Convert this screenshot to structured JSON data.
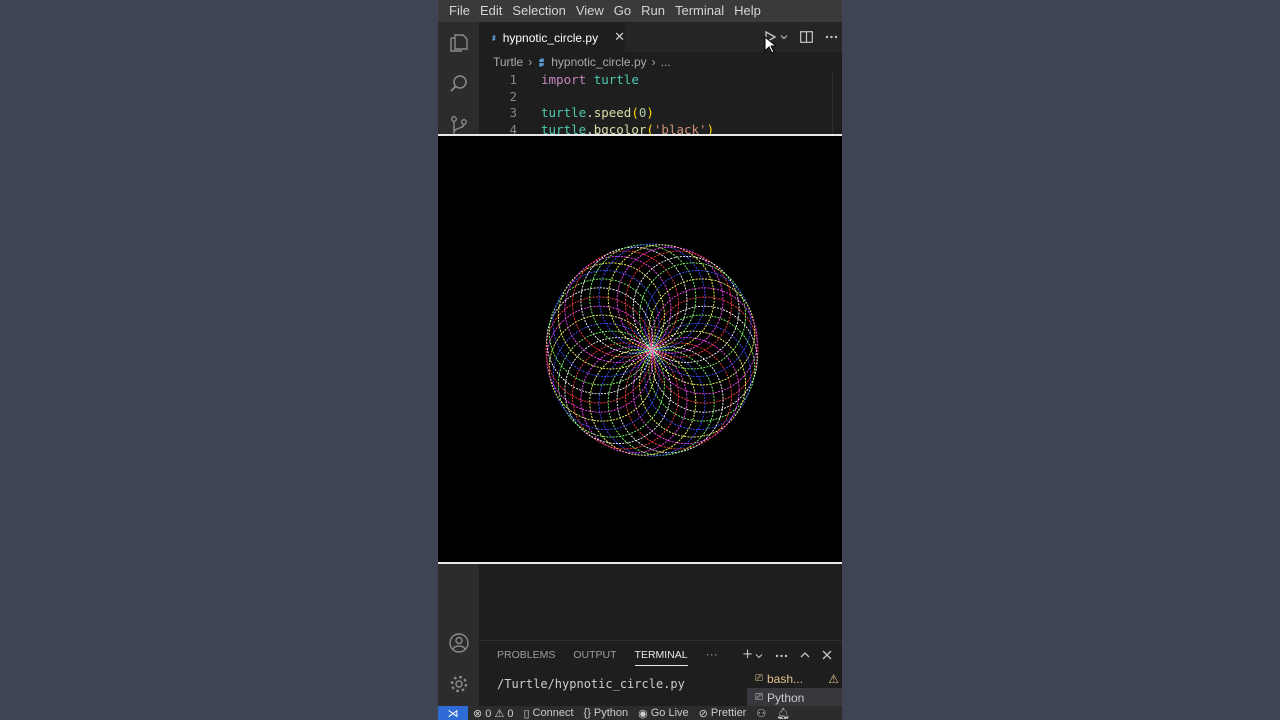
{
  "menu": [
    "File",
    "Edit",
    "Selection",
    "View",
    "Go",
    "Run",
    "Terminal",
    "Help"
  ],
  "tab": {
    "label": "hypnotic_circle.py",
    "close": "✕"
  },
  "breadcrumb": {
    "folder": "Turtle",
    "file": "hypnotic_circle.py",
    "more": "..."
  },
  "code": [
    {
      "n": "1",
      "tokens": [
        {
          "t": "import",
          "c": "kw"
        },
        {
          "t": " ",
          "c": "pn"
        },
        {
          "t": "turtle",
          "c": "id"
        }
      ]
    },
    {
      "n": "2",
      "tokens": []
    },
    {
      "n": "3",
      "tokens": [
        {
          "t": "turtle",
          "c": "id"
        },
        {
          "t": ".",
          "c": "pn"
        },
        {
          "t": "speed",
          "c": "fn"
        },
        {
          "t": "(",
          "c": "br"
        },
        {
          "t": "0",
          "c": "num"
        },
        {
          "t": ")",
          "c": "br"
        }
      ]
    },
    {
      "n": "4",
      "tokens": [
        {
          "t": "turtle",
          "c": "id"
        },
        {
          "t": ".",
          "c": "pn"
        },
        {
          "t": "bgcolor",
          "c": "fn"
        },
        {
          "t": "(",
          "c": "br"
        },
        {
          "t": "'black'",
          "c": "str"
        },
        {
          "t": ")",
          "c": "br"
        }
      ]
    }
  ],
  "drawing": {
    "circles": 36,
    "palette": [
      "#ff3b3b",
      "#ffffff",
      "#7cff6b",
      "#3b4bff",
      "#ffff66",
      "#ff40ff"
    ]
  },
  "panel": {
    "tabs": [
      "PROBLEMS",
      "OUTPUT",
      "TERMINAL"
    ],
    "active_tab": "TERMINAL",
    "more": "···",
    "terminal_line": "/Turtle/hypnotic_circle.py",
    "terminals": [
      {
        "label": "bash...",
        "color": "#e2c08d",
        "warning": "⚠"
      },
      {
        "label": "Python",
        "color": "#cccccc"
      }
    ]
  },
  "status": {
    "remote": "⋊",
    "problems": "⊗ 0 ⚠ 0",
    "connect": "Connect",
    "python": "Python",
    "golive": "Go Live",
    "prettier": "Prettier"
  }
}
